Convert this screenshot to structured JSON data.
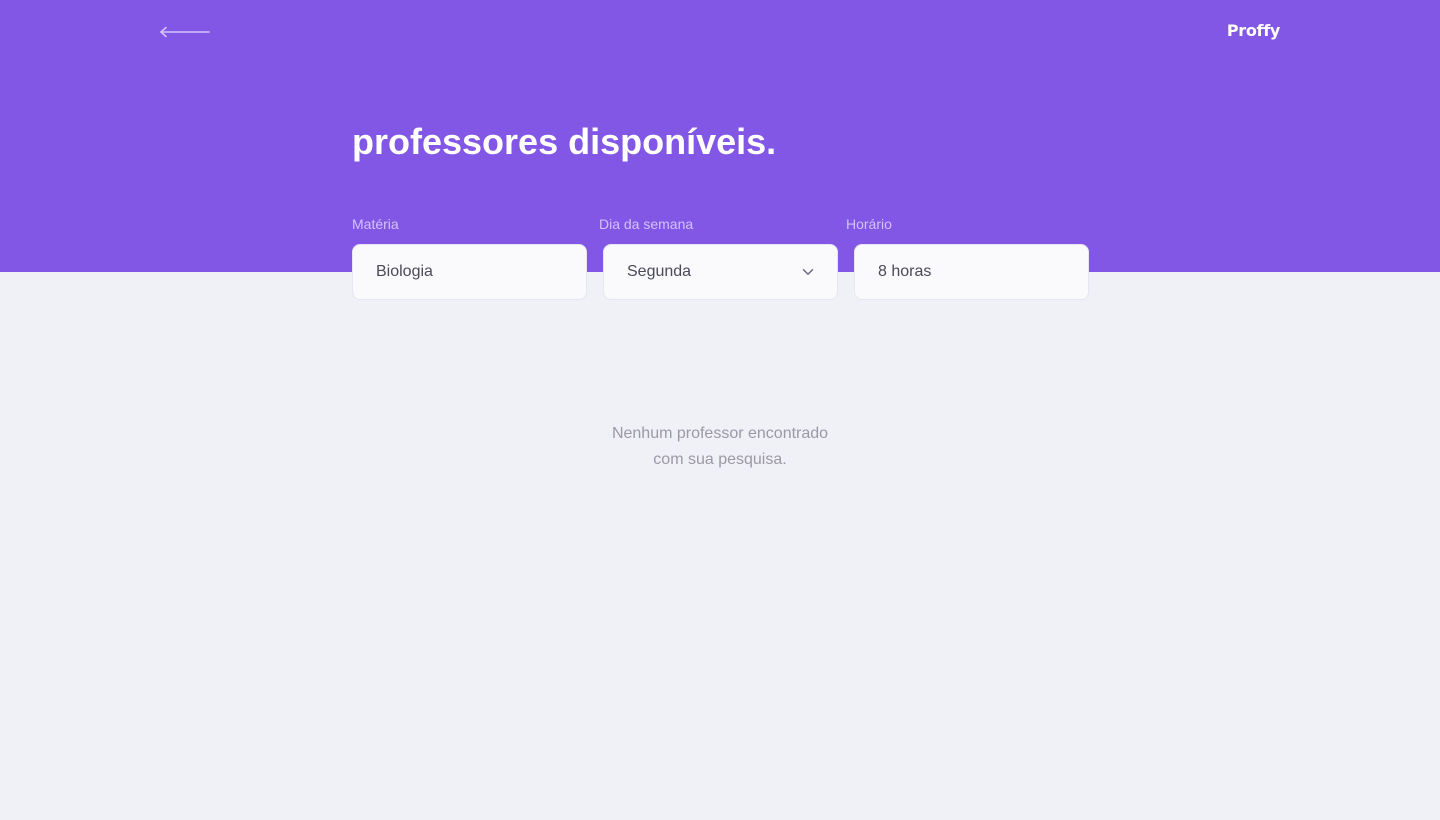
{
  "header": {
    "logo": "Proffy",
    "back_icon": "arrow-left-icon",
    "title": "professores disponíveis."
  },
  "filters": {
    "materia": {
      "label": "Matéria",
      "value": "Biologia"
    },
    "dia_semana": {
      "label": "Dia da semana",
      "value": "Segunda",
      "icon": "chevron-down-icon"
    },
    "horario": {
      "label": "Horário",
      "value": "8 horas"
    }
  },
  "results": {
    "empty_line1": "Nenhum professor encontrado",
    "empty_line2": "com sua pesquisa."
  },
  "colors": {
    "primary": "#8257E5",
    "background": "#F0F0F7",
    "input_bg": "#FAFAFC",
    "label": "#D4C2FF",
    "muted_text": "#9C98A6"
  }
}
